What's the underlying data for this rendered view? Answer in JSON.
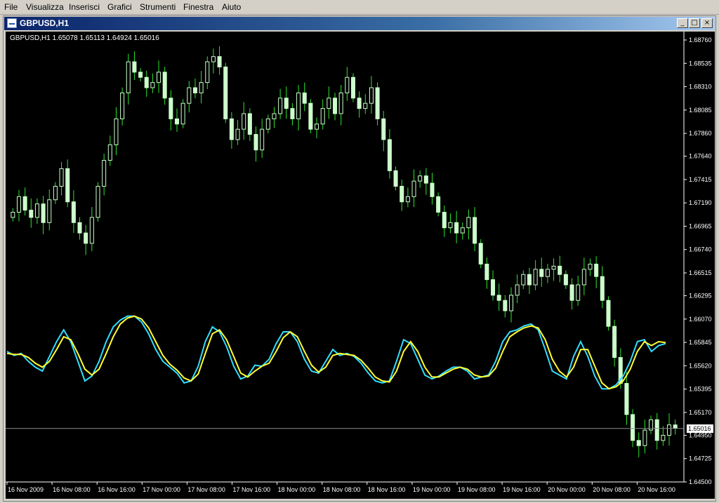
{
  "menu": [
    "File",
    "Visualizza",
    "Inserisci",
    "Grafici",
    "Strumenti",
    "Finestra",
    "Aiuto"
  ],
  "window": {
    "title": "GBPUSD,H1",
    "minimize": "_",
    "maximize": "□",
    "close": "×"
  },
  "chart": {
    "header": "GBPUSD,H1  1.65078 1.65113 1.64924 1.65016",
    "current_price": "1.65016",
    "colors": {
      "bull": "#ccffcc",
      "wick": "#2ee62e",
      "fast_line": "#33ddff",
      "slow_line": "#ffff33",
      "axis_text": "#ffffff",
      "background": "#000000"
    }
  },
  "chart_data": {
    "type": "candlestick",
    "symbol": "GBPUSD",
    "timeframe": "H1",
    "y_ticks": [
      "1.68760",
      "1.68535",
      "1.68310",
      "1.68085",
      "1.67860",
      "1.67640",
      "1.67415",
      "1.67190",
      "1.66965",
      "1.66740",
      "1.66515",
      "1.66295",
      "1.66070",
      "1.65845",
      "1.65620",
      "1.65395",
      "1.65170",
      "1.64950",
      "1.64725",
      "1.64500"
    ],
    "ylim": [
      1.645,
      1.6876
    ],
    "x_ticks": [
      "16 Nov 2009",
      "16 Nov 08:00",
      "16 Nov 16:00",
      "17 Nov 00:00",
      "17 Nov 08:00",
      "17 Nov 16:00",
      "18 Nov 00:00",
      "18 Nov 08:00",
      "18 Nov 16:00",
      "19 Nov 00:00",
      "19 Nov 08:00",
      "19 Nov 16:00",
      "20 Nov 00:00",
      "20 Nov 08:00",
      "20 Nov 16:00"
    ],
    "last_price": 1.65016,
    "closes": [
      1.671,
      1.6725,
      1.6712,
      1.6705,
      1.6718,
      1.67,
      1.6722,
      1.6735,
      1.6752,
      1.672,
      1.67,
      1.669,
      1.668,
      1.6705,
      1.6735,
      1.676,
      1.6775,
      1.68,
      1.6825,
      1.6855,
      1.6845,
      1.684,
      1.683,
      1.6835,
      1.6845,
      1.682,
      1.68,
      1.6795,
      1.6815,
      1.683,
      1.6825,
      1.6835,
      1.6855,
      1.686,
      1.685,
      1.68,
      1.678,
      1.679,
      1.6805,
      1.6785,
      1.677,
      1.679,
      1.68,
      1.6805,
      1.682,
      1.681,
      1.68,
      1.6825,
      1.6815,
      1.679,
      1.6795,
      1.681,
      1.682,
      1.6805,
      1.6825,
      1.684,
      1.682,
      1.681,
      1.6815,
      1.683,
      1.68,
      1.678,
      1.675,
      1.6735,
      1.672,
      1.6725,
      1.674,
      1.6745,
      1.6738,
      1.6725,
      1.671,
      1.6695,
      1.67,
      1.669,
      1.6695,
      1.6705,
      1.668,
      1.666,
      1.6645,
      1.663,
      1.6625,
      1.6615,
      1.663,
      1.664,
      1.665,
      1.664,
      1.6655,
      1.6648,
      1.6655,
      1.6658,
      1.665,
      1.664,
      1.6625,
      1.664,
      1.6655,
      1.666,
      1.6648,
      1.6625,
      1.66,
      1.657,
      1.6545,
      1.6515,
      1.649,
      1.6485,
      1.65,
      1.651,
      1.649,
      1.6495,
      1.6505,
      1.6502
    ],
    "series": [
      {
        "name": "fast",
        "values": [
          0.6,
          0.56,
          0.58,
          0.5,
          0.44,
          0.4,
          0.55,
          0.7,
          0.82,
          0.7,
          0.5,
          0.3,
          0.35,
          0.5,
          0.7,
          0.85,
          0.92,
          0.96,
          0.96,
          0.9,
          0.78,
          0.62,
          0.5,
          0.44,
          0.38,
          0.28,
          0.3,
          0.45,
          0.7,
          0.85,
          0.8,
          0.65,
          0.45,
          0.32,
          0.35,
          0.46,
          0.45,
          0.52,
          0.68,
          0.8,
          0.8,
          0.7,
          0.52,
          0.4,
          0.38,
          0.5,
          0.62,
          0.56,
          0.58,
          0.55,
          0.48,
          0.38,
          0.3,
          0.28,
          0.3,
          0.5,
          0.72,
          0.68,
          0.52,
          0.36,
          0.32,
          0.35,
          0.4,
          0.44,
          0.44,
          0.4,
          0.32,
          0.34,
          0.36,
          0.5,
          0.7,
          0.8,
          0.82,
          0.86,
          0.88,
          0.82,
          0.62,
          0.4,
          0.36,
          0.32,
          0.55,
          0.7,
          0.55,
          0.35,
          0.22,
          0.22,
          0.26,
          0.35,
          0.5,
          0.7,
          0.72,
          0.6,
          0.66,
          0.68
        ]
      },
      {
        "name": "slow",
        "values": [
          0.58,
          0.57,
          0.57,
          0.54,
          0.48,
          0.44,
          0.5,
          0.62,
          0.75,
          0.72,
          0.58,
          0.42,
          0.36,
          0.42,
          0.58,
          0.75,
          0.88,
          0.94,
          0.96,
          0.93,
          0.84,
          0.7,
          0.56,
          0.47,
          0.41,
          0.33,
          0.3,
          0.37,
          0.58,
          0.78,
          0.82,
          0.72,
          0.55,
          0.38,
          0.34,
          0.4,
          0.45,
          0.48,
          0.6,
          0.74,
          0.8,
          0.75,
          0.6,
          0.46,
          0.39,
          0.44,
          0.56,
          0.58,
          0.57,
          0.56,
          0.51,
          0.43,
          0.34,
          0.3,
          0.29,
          0.4,
          0.6,
          0.7,
          0.6,
          0.44,
          0.34,
          0.34,
          0.38,
          0.42,
          0.44,
          0.42,
          0.36,
          0.34,
          0.35,
          0.43,
          0.6,
          0.75,
          0.8,
          0.84,
          0.86,
          0.84,
          0.72,
          0.52,
          0.4,
          0.34,
          0.44,
          0.62,
          0.62,
          0.45,
          0.28,
          0.22,
          0.24,
          0.3,
          0.42,
          0.6,
          0.7,
          0.66,
          0.7,
          0.69
        ]
      }
    ]
  }
}
